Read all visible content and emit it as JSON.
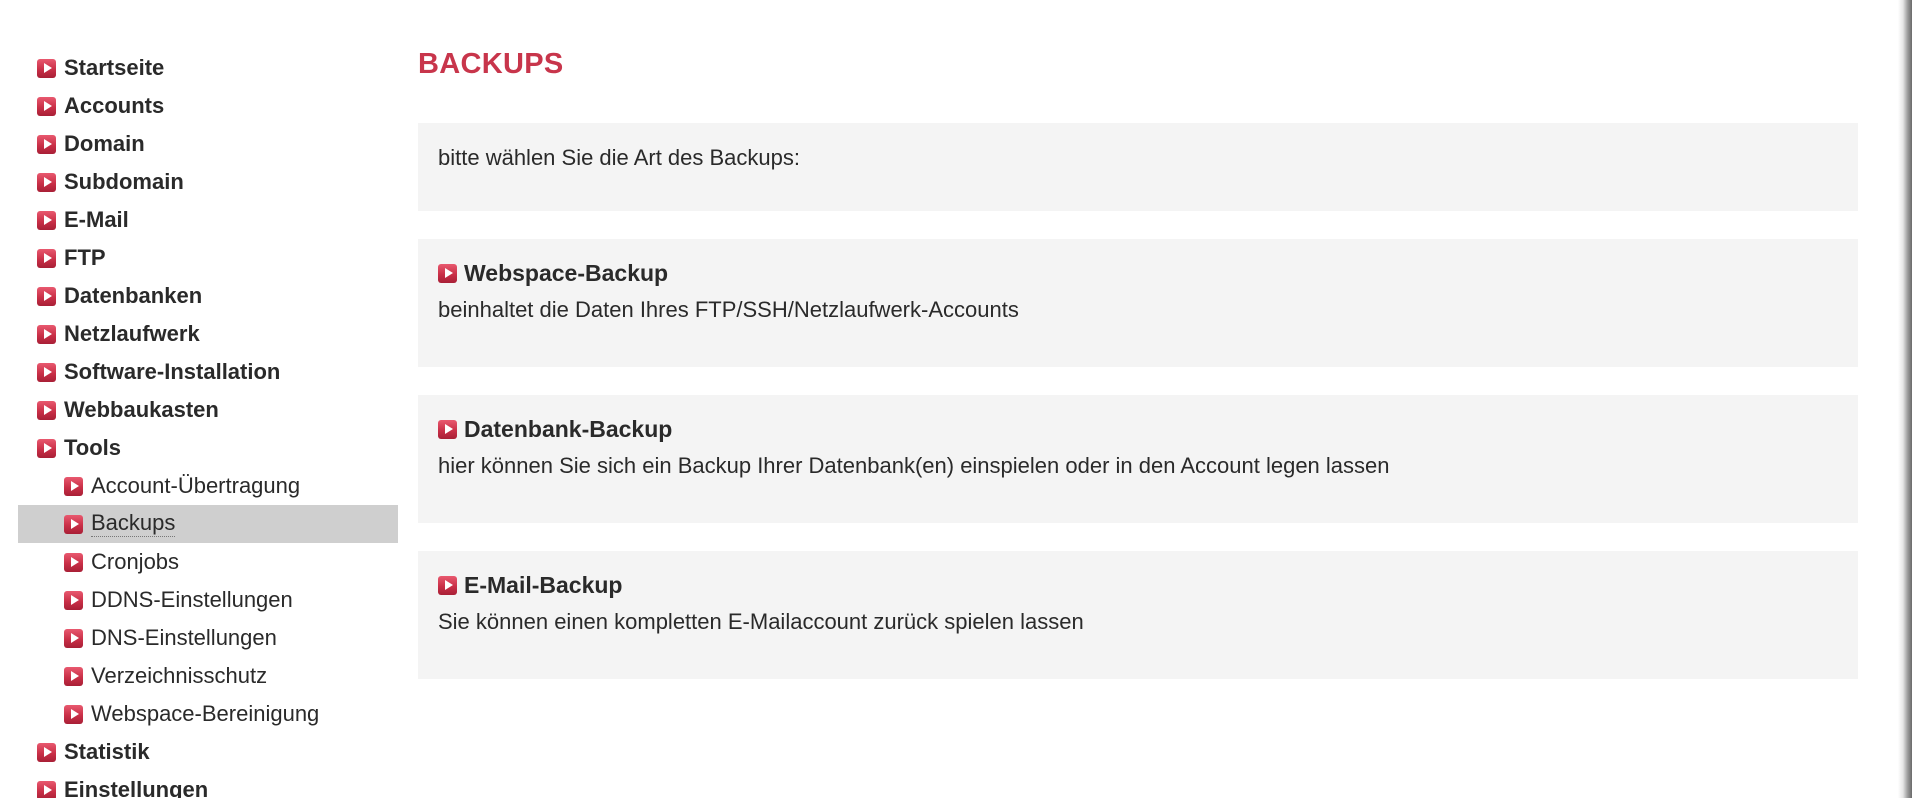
{
  "sidebar": {
    "items": [
      {
        "label": "Startseite"
      },
      {
        "label": "Accounts"
      },
      {
        "label": "Domain"
      },
      {
        "label": "Subdomain"
      },
      {
        "label": "E-Mail"
      },
      {
        "label": "FTP"
      },
      {
        "label": "Datenbanken"
      },
      {
        "label": "Netzlaufwerk"
      },
      {
        "label": "Software-Installation"
      },
      {
        "label": "Webbaukasten"
      },
      {
        "label": "Tools"
      },
      {
        "label": "Statistik"
      },
      {
        "label": "Einstellungen"
      }
    ],
    "tools_subitems": [
      {
        "label": "Account-Übertragung"
      },
      {
        "label": "Backups",
        "active": true
      },
      {
        "label": "Cronjobs"
      },
      {
        "label": "DDNS-Einstellungen"
      },
      {
        "label": "DNS-Einstellungen"
      },
      {
        "label": "Verzeichnisschutz"
      },
      {
        "label": "Webspace-Bereinigung"
      }
    ]
  },
  "main": {
    "title": "BACKUPS",
    "intro": "bitte wählen Sie die Art des Backups:",
    "options": [
      {
        "title": "Webspace-Backup",
        "description": "beinhaltet die Daten Ihres FTP/SSH/Netzlaufwerk-Accounts"
      },
      {
        "title": "Datenbank-Backup",
        "description": "hier können Sie sich ein Backup Ihrer Datenbank(en) einspielen oder in den Account legen lassen"
      },
      {
        "title": "E-Mail-Backup",
        "description": "Sie können einen kompletten E-Mailaccount zurück spielen lassen"
      }
    ]
  },
  "icons": {
    "nav_arrow": "arrow-right-icon"
  },
  "colors": {
    "accent": "#c8354b",
    "active_bg": "#cfcfcf",
    "box_bg": "#f4f4f4"
  }
}
